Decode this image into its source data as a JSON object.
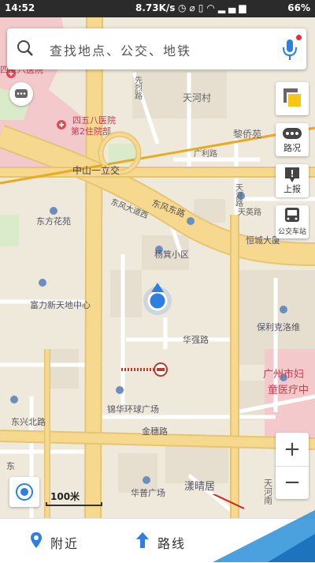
{
  "status_bar": {
    "time": "14:52",
    "network_speed": "8.73K/s",
    "battery": "66%"
  },
  "search": {
    "placeholder": "查找地点、公交、地铁"
  },
  "map_labels": [
    "四五八医院",
    "四五八医院",
    "第2住院部",
    "天河村",
    "黎侨苑",
    "广利路",
    "中山一立交",
    "东风东路",
    "东风大道西",
    "天涯路",
    "东方花苑",
    "天英路",
    "恒城大厦",
    "杨箕小区",
    "富力新天地中心",
    "华强路",
    "保利克洛维",
    "广州市妇",
    "童医疗中",
    "东兴北路",
    "锦华环球广场",
    "金穗路",
    "华普广场",
    "漾晴居",
    "东",
    "先烈路",
    "天河南"
  ],
  "right_tools": {
    "traffic_label": "路况",
    "report_label": "上报",
    "bus_label": "公交车站"
  },
  "scale": {
    "label": "100米"
  },
  "bottom_nav": {
    "nearby_label": "附近",
    "route_label": "路线"
  },
  "colors": {
    "accent": "#2d7fe0",
    "road": "#f6d98f",
    "road_edge": "#e5c472",
    "expressway": "#f3c84a",
    "hospital_area": "#f4c9cc",
    "park": "#d9ebc8"
  }
}
